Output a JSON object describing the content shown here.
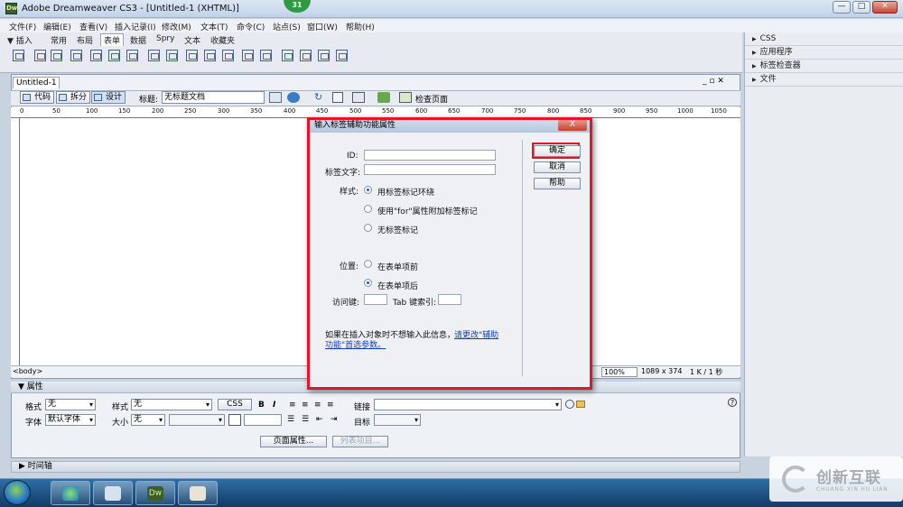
{
  "window": {
    "app_icon": "Dw",
    "title": "Adobe Dreamweaver CS3 - [Untitled-1 (XHTML)]",
    "badge": "31",
    "min_label": "—",
    "max_label": "□",
    "close_label": "✕"
  },
  "menu": [
    "文件(F)",
    "编辑(E)",
    "查看(V)",
    "插入记录(I)",
    "修改(M)",
    "文本(T)",
    "命令(C)",
    "站点(S)",
    "窗口(W)",
    "帮助(H)"
  ],
  "insert_bar": {
    "title": "▼ 插入",
    "tabs": [
      "常用",
      "布局",
      "表单",
      "数据",
      "Spry",
      "文本",
      "收藏夹"
    ],
    "active_tab": "表单"
  },
  "right_panel": [
    "CSS",
    "应用程序",
    "标签检查器",
    "文件"
  ],
  "document": {
    "tab_label": "Untitled-1",
    "view_buttons": [
      "代码",
      "拆分",
      "设计"
    ],
    "title_label": "标题:",
    "title_value": "无标题文档",
    "check_page": "检查页面",
    "ruler_labels": [
      "0",
      "50",
      "100",
      "150",
      "200",
      "250",
      "300",
      "350",
      "400",
      "450",
      "500",
      "550",
      "600",
      "650",
      "700",
      "750",
      "800",
      "850",
      "900",
      "950",
      "1000",
      "1050"
    ],
    "win_controls": "_ ▫ ✕"
  },
  "status": {
    "tag": "<body>",
    "zoom": "100%",
    "size": "1089 x 374",
    "weight": "1 K / 1 秒"
  },
  "properties": {
    "header": "▼ 属性",
    "format_label": "格式",
    "format_value": "无",
    "style_label": "样式",
    "style_value": "无",
    "css_button": "CSS",
    "bold": "B",
    "italic": "I",
    "link_label": "链接",
    "font_label": "字体",
    "font_value": "默认字体",
    "size_label": "大小",
    "size_value": "无",
    "target_label": "目标",
    "page_props_button": "页面属性...",
    "list_item_button": "列表项目..."
  },
  "timeline": "▶ 时间轴",
  "dialog": {
    "title": "输入标签辅助功能属性",
    "close": "X",
    "id_label": "ID:",
    "label_text_label": "标签文字:",
    "style_label": "样式:",
    "style_options": [
      "用标签标记环绕",
      "使用\"for\"属性附加标签标记",
      "无标签标记"
    ],
    "style_selected": 0,
    "position_label": "位置:",
    "position_options": [
      "在表单项前",
      "在表单项后"
    ],
    "position_selected": 1,
    "access_key_label": "访问键:",
    "tab_index_label": "Tab 键索引:",
    "info_text": "如果在插入对象时不想输入此信息，",
    "info_link_1": "请更改\"辅助",
    "info_link_2": "功能\"首选参数。",
    "buttons": [
      "确定",
      "取消",
      "帮助"
    ]
  },
  "taskbar": {
    "dw_label": "Dw"
  },
  "watermark": {
    "cn": "创新互联",
    "en": "CHUANG XIN HU LIAN"
  }
}
